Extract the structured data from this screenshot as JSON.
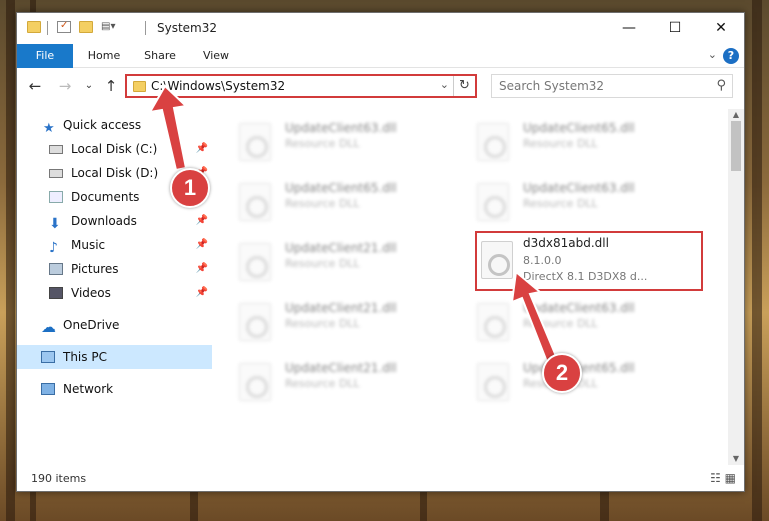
{
  "window": {
    "title": "System32",
    "controls": {
      "minimize": "—",
      "maximize": "☐",
      "close": "✕"
    }
  },
  "ribbon": {
    "tabs": [
      {
        "label": "File"
      },
      {
        "label": "Home"
      },
      {
        "label": "Share"
      },
      {
        "label": "View"
      }
    ],
    "help": "?"
  },
  "address_bar": {
    "path": "C:\\Windows\\System32"
  },
  "search": {
    "placeholder": "Search System32"
  },
  "sidebar": {
    "items": [
      {
        "label": "Quick access",
        "pinned": false
      },
      {
        "label": "Local Disk (C:)",
        "pinned": true
      },
      {
        "label": "Local Disk (D:)",
        "pinned": true
      },
      {
        "label": "Documents",
        "pinned": true
      },
      {
        "label": "Downloads",
        "pinned": true
      },
      {
        "label": "Music",
        "pinned": true
      },
      {
        "label": "Pictures",
        "pinned": true
      },
      {
        "label": "Videos",
        "pinned": true
      },
      {
        "label": "OneDrive",
        "pinned": false
      },
      {
        "label": "This PC",
        "pinned": false,
        "selected": true
      },
      {
        "label": "Network",
        "pinned": false
      }
    ]
  },
  "files": {
    "left_column": [
      {
        "name": "UpdateClient63.dll",
        "desc": "Resource DLL"
      },
      {
        "name": "UpdateClient65.dll",
        "desc": "Resource DLL"
      },
      {
        "name": "UpdateClient21.dll",
        "desc": "Resource DLL"
      },
      {
        "name": "UpdateClient21.dll",
        "desc": "Resource DLL"
      },
      {
        "name": "UpdateClient21.dll",
        "desc": "Resource DLL"
      }
    ],
    "right_column": [
      {
        "name": "UpdateClient65.dll",
        "desc": "Resource DLL"
      },
      {
        "name": "UpdateClient63.dll",
        "desc": "Resource DLL"
      },
      {
        "name": "UpdateClient63.dll",
        "desc": "Resource DLL"
      },
      {
        "name": "UpdateClient65.dll",
        "desc": "Resource DLL"
      }
    ],
    "highlighted": {
      "name": "d3dx81abd.dll",
      "version": "8.1.0.0",
      "desc": "DirectX 8.1 D3DX8 d..."
    }
  },
  "status": {
    "items_count": "190 items"
  },
  "callouts": {
    "one": "1",
    "two": "2"
  },
  "colors": {
    "highlight_red": "#d23b3b",
    "file_tab_blue": "#1979ca",
    "selection": "#cce8ff"
  }
}
